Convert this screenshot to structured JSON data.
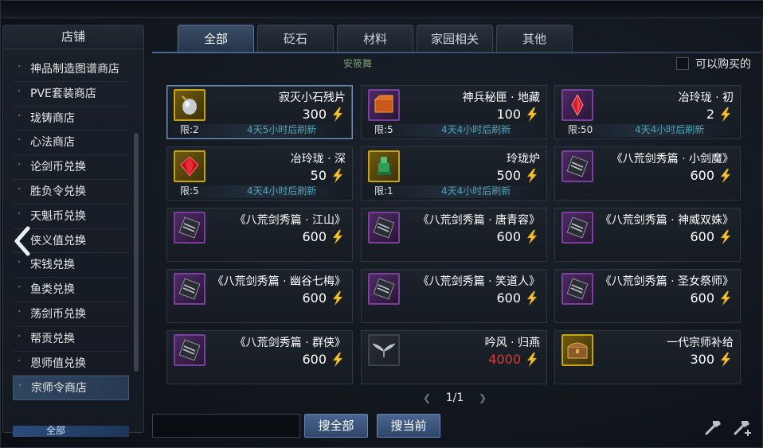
{
  "sidebar": {
    "title": "店铺",
    "items": [
      {
        "label": "神品制造图谱商店",
        "active": false
      },
      {
        "label": "PVE套装商店",
        "active": false
      },
      {
        "label": "珑铸商店",
        "active": false
      },
      {
        "label": "心法商店",
        "active": false
      },
      {
        "label": "论剑币兑换",
        "active": false
      },
      {
        "label": "胜负令兑换",
        "active": false
      },
      {
        "label": "天魁币兑换",
        "active": false
      },
      {
        "label": "侠义值兑换",
        "active": false
      },
      {
        "label": "宋钱兑换",
        "active": false
      },
      {
        "label": "鱼类兑换",
        "active": false
      },
      {
        "label": "荡剑币兑换",
        "active": false
      },
      {
        "label": "帮贡兑换",
        "active": false
      },
      {
        "label": "恩师值兑换",
        "active": false
      },
      {
        "label": "宗师令商店",
        "active": true
      }
    ],
    "sub_item": "全部"
  },
  "tabs": [
    "全部",
    "砭石",
    "材料",
    "家园相关",
    "其他"
  ],
  "active_tab": 0,
  "header": {
    "badge_text": "安筱舞",
    "affordable_label": "可以购买的"
  },
  "items": [
    {
      "name": "寂灭小石残片",
      "price": "300",
      "limit": "限:2",
      "refresh": "4天5小时后刷新",
      "icon": "gray-stone-icon",
      "frame": "gold",
      "selected": true
    },
    {
      "name": "神兵秘匣 · 地藏",
      "price": "100",
      "limit": "限:5",
      "refresh": "4天4小时后刷新",
      "icon": "orange-box-icon",
      "frame": "purple"
    },
    {
      "name": "冶玲珑 · 初",
      "price": "2",
      "limit": "限:50",
      "refresh": "4天4小时后刷新",
      "icon": "red-crystal-icon",
      "frame": "purple"
    },
    {
      "name": "冶玲珑 · 深",
      "price": "50",
      "limit": "限:5",
      "refresh": "4天4小时后刷新",
      "icon": "red-gem-icon",
      "frame": "gold"
    },
    {
      "name": "玲珑炉",
      "price": "500",
      "limit": "限:1",
      "refresh": "4天4小时后刷新",
      "icon": "green-furnace-icon",
      "frame": "gold"
    },
    {
      "name": "《八荒剑秀篇 · 小剑魔》",
      "price": "600",
      "icon": "scroll-icon",
      "frame": "purple"
    },
    {
      "name": "《八荒剑秀篇 · 江山》",
      "price": "600",
      "icon": "scroll-icon",
      "frame": "purple"
    },
    {
      "name": "《八荒剑秀篇 · 唐青容》",
      "price": "600",
      "icon": "scroll-icon",
      "frame": "purple"
    },
    {
      "name": "《八荒剑秀篇 · 神威双姝》",
      "price": "600",
      "icon": "scroll-icon",
      "frame": "purple"
    },
    {
      "name": "《八荒剑秀篇 · 幽谷七梅》",
      "price": "600",
      "icon": "scroll-icon",
      "frame": "purple"
    },
    {
      "name": "《八荒剑秀篇 · 笑道人》",
      "price": "600",
      "icon": "scroll-icon",
      "frame": "purple"
    },
    {
      "name": "《八荒剑秀篇 · 圣女祭师》",
      "price": "600",
      "icon": "scroll-icon",
      "frame": "purple"
    },
    {
      "name": "《八荒剑秀篇 · 群侠》",
      "price": "600",
      "icon": "scroll-icon",
      "frame": "purple"
    },
    {
      "name": "吟风 · 归燕",
      "price": "4000",
      "price_color": "#e23a2e",
      "icon": "wings-icon",
      "frame": "plain"
    },
    {
      "name": "一代宗师补给",
      "price": "300",
      "icon": "treasure-chest-icon",
      "frame": "gold"
    }
  ],
  "pager": {
    "label": "1/1"
  },
  "buttons": {
    "search_all": "搜全部",
    "search_current": "搜当前"
  },
  "colors": {
    "accent": "#4a6590",
    "currency": "#f2c230",
    "refresh": "#4fa4b6",
    "expensive": "#e23a2e"
  }
}
